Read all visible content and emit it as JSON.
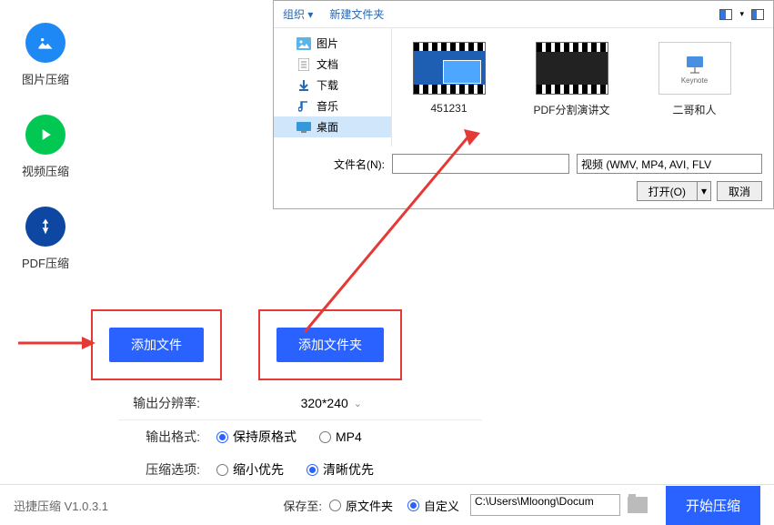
{
  "sidebar": {
    "items": [
      {
        "label": "图片压缩"
      },
      {
        "label": "视频压缩"
      },
      {
        "label": "PDF压缩"
      }
    ]
  },
  "dialog": {
    "organize": "组织",
    "new_folder": "新建文件夹",
    "tree": [
      {
        "label": "图片"
      },
      {
        "label": "文档"
      },
      {
        "label": "下载"
      },
      {
        "label": "音乐"
      },
      {
        "label": "桌面"
      }
    ],
    "files": [
      {
        "label": "451231"
      },
      {
        "label": "PDF分割演讲文"
      },
      {
        "label": "二哥和人"
      }
    ],
    "filename_label": "文件名(N):",
    "filter": "视频 (WMV, MP4, AVI, FLV",
    "open_label": "打开(O)",
    "cancel_label": "取消"
  },
  "buttons": {
    "add_file": "添加文件",
    "add_folder": "添加文件夹"
  },
  "settings": {
    "resolution_label": "输出分辨率:",
    "resolution_value": "320*240",
    "format_label": "输出格式:",
    "format_keep": "保持原格式",
    "format_mp4": "MP4",
    "compress_label": "压缩选项:",
    "compress_shrink": "缩小优先",
    "compress_clear": "清晰优先"
  },
  "bottom": {
    "version": "迅捷压缩 V1.0.3.1",
    "save_to": "保存至:",
    "opt_original": "原文件夹",
    "opt_custom": "自定义",
    "path": "C:\\Users\\Mloong\\Docum",
    "start": "开始压缩"
  },
  "keynote_label": "Keynote"
}
